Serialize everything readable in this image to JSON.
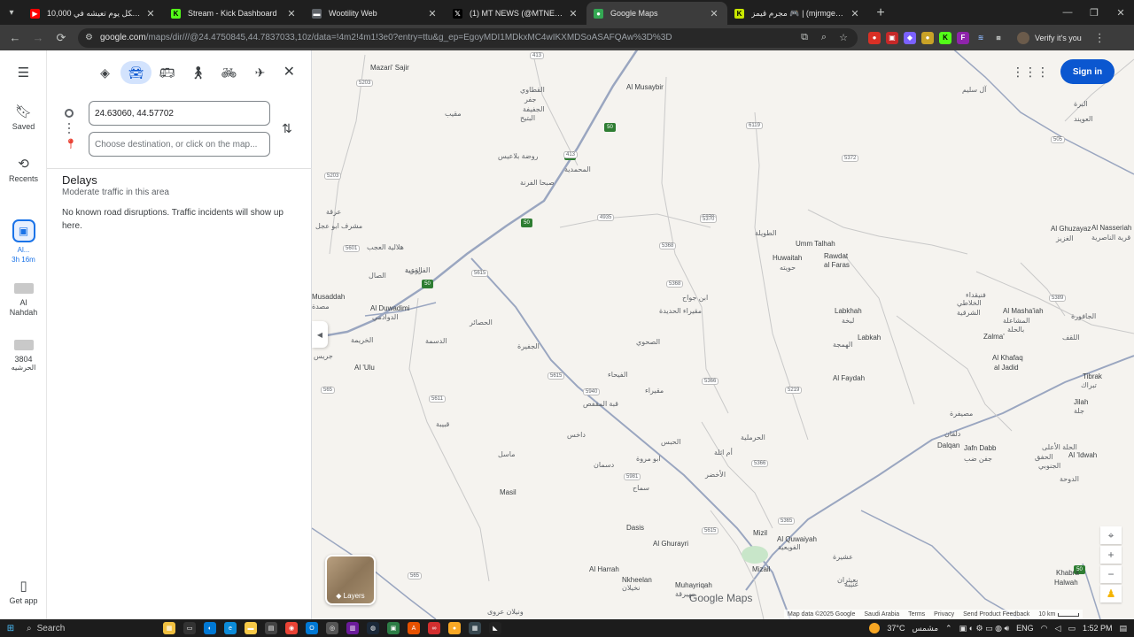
{
  "browser": {
    "tabs": [
      {
        "title": "10,000 ريال لكل يوم تعيشه في...",
        "favicon_color": "#ff0000",
        "active": false
      },
      {
        "title": "Stream - Kick Dashboard",
        "favicon_color": "#53fc18",
        "active": false
      },
      {
        "title": "Wootility Web",
        "favicon_color": "#5f6368",
        "active": false
      },
      {
        "title": "(1) MT NEWS (@MTNEWS_) / X",
        "favicon_color": "#000000",
        "active": false
      },
      {
        "title": "Google Maps",
        "favicon_color": "#34a853",
        "active": true
      },
      {
        "title": "مجرم قيمز 🎮 | (mjrmgems@) - ...",
        "favicon_color": "#c8e600",
        "active": false
      }
    ],
    "url_domain": "google.com",
    "url_path": "/maps/dir///@24.4750845,44.7837033,10z/data=!4m2!4m1!3e0?entry=ttu&g_ep=EgoyMDI1MDkxMC4wIKXMDSoASAFQAw%3D%3D",
    "profile_label": "Verify it's you"
  },
  "maps": {
    "rail": {
      "saved": "Saved",
      "recents": "Recents",
      "active_route_label": "Al...",
      "active_route_time": "3h 16m",
      "item2_label": "Al Nahdah",
      "item3_label_line1": "3804",
      "item3_label_line2": "الحرشيه",
      "get_app": "Get app"
    },
    "directions": {
      "origin_value": "24.63060, 44.57702",
      "destination_placeholder": "Choose destination, or click on the map...",
      "delays_title": "Delays",
      "delays_sub": "Moderate traffic in this area",
      "delays_body": "No known road disruptions. Traffic incidents will show up here."
    },
    "signin": "Sign in",
    "layers": "Layers",
    "logo": "Google Maps",
    "attribution": {
      "data": "Map data ©2025 Google",
      "country": "Saudi Arabia",
      "terms": "Terms",
      "privacy": "Privacy",
      "feedback": "Send Product Feedback",
      "scale": "10 km"
    },
    "places": [
      {
        "t": "Mazari' Sajir"
      },
      {
        "t": "القطاوي"
      },
      {
        "t": "جفر"
      },
      {
        "t": "الجفيفة"
      },
      {
        "t": "البتيح"
      },
      {
        "t": "مقيب"
      },
      {
        "t": "روضة بلاعيس"
      },
      {
        "t": "المحمدية"
      },
      {
        "t": "صبحا الفرنة"
      },
      {
        "t": "Al Musaybir"
      },
      {
        "t": "عرقة"
      },
      {
        "t": "مشرف ابو عجل"
      },
      {
        "t": "هلالية العجب"
      },
      {
        "t": "القرية"
      },
      {
        "t": "الطويلة"
      },
      {
        "t": "Umm Talhah"
      },
      {
        "t": "Huwaitah"
      },
      {
        "t": "حويته"
      },
      {
        "t": "Rawdat"
      },
      {
        "t": "al Faras"
      },
      {
        "t": "Al Ghuzayaz"
      },
      {
        "t": "الغزيز"
      },
      {
        "t": "Al Nasseriah"
      },
      {
        "t": "قرية الناصرية"
      },
      {
        "t": "الفرزعية"
      },
      {
        "t": "الصال"
      },
      {
        "t": "Musaddah"
      },
      {
        "t": "مصدة"
      },
      {
        "t": "Al Duwadimi"
      },
      {
        "t": "الدوادمي"
      },
      {
        "t": "الخريمة"
      },
      {
        "t": "Al 'Ulu"
      },
      {
        "t": "جريس"
      },
      {
        "t": "الدسمة"
      },
      {
        "t": "الحصائر"
      },
      {
        "t": "الجفيرة"
      },
      {
        "t": "ابن جواح"
      },
      {
        "t": "مقيراء الحديدة"
      },
      {
        "t": "الصحوي"
      },
      {
        "t": "Labkhah"
      },
      {
        "t": "لبخة"
      },
      {
        "t": "Labkah"
      },
      {
        "t": "الهمجة"
      },
      {
        "t": "فنيقداء"
      },
      {
        "t": "الخلاطي"
      },
      {
        "t": "الشرقية"
      },
      {
        "t": "Al Masha'iah"
      },
      {
        "t": "المشاعلة"
      },
      {
        "t": "بالحلة"
      },
      {
        "t": "الجافورة"
      },
      {
        "t": "Zalma'"
      },
      {
        "t": "اللقف"
      },
      {
        "t": "Al Khafaq"
      },
      {
        "t": "al Jadid"
      },
      {
        "t": "Tibrak"
      },
      {
        "t": "تبراك"
      },
      {
        "t": "Al Faydah"
      },
      {
        "t": "الفيحاء"
      },
      {
        "t": "مقيراء"
      },
      {
        "t": "قبة المقفص"
      },
      {
        "t": "قبيبة"
      },
      {
        "t": "داخس"
      },
      {
        "t": "ماسل"
      },
      {
        "t": "Masil"
      },
      {
        "t": "الحبس"
      },
      {
        "t": "ابو مروة"
      },
      {
        "t": "دسمان"
      },
      {
        "t": "سماح"
      },
      {
        "t": "أم اثلة"
      },
      {
        "t": "الأخضر"
      },
      {
        "t": "الحرملية"
      },
      {
        "t": "مصيفرة"
      },
      {
        "t": "دلقان"
      },
      {
        "t": "Dalqan"
      },
      {
        "t": "Jafn Dabb"
      },
      {
        "t": "جفن ضب"
      },
      {
        "t": "الحلة الأعلى"
      },
      {
        "t": "الحفق"
      },
      {
        "t": "الجنوبي"
      },
      {
        "t": "Jilah"
      },
      {
        "t": "جلة"
      },
      {
        "t": "Al 'Idwah"
      },
      {
        "t": "الدوحة"
      },
      {
        "t": "Dasis"
      },
      {
        "t": "Al Ghurayri"
      },
      {
        "t": "Mizil"
      },
      {
        "t": "Al Quwaiyah"
      },
      {
        "t": "الفويعية"
      },
      {
        "t": "Mizail"
      },
      {
        "t": "عشيرة"
      },
      {
        "t": "Al Harrah"
      },
      {
        "t": "Nkheelan"
      },
      {
        "t": "نخيلان"
      },
      {
        "t": "Muhayriqah"
      },
      {
        "t": "مهيرقة"
      },
      {
        "t": "بعيثران"
      },
      {
        "t": "عنيبة"
      },
      {
        "t": "Khabra"
      },
      {
        "t": "Halwah"
      },
      {
        "t": "ونيلان عروى"
      },
      {
        "t": "البرة"
      },
      {
        "t": "العويند"
      },
      {
        "t": "آل سليم"
      }
    ],
    "route_labels": [
      "5203",
      "413",
      "413",
      "6119",
      "5372",
      "5370",
      "4935",
      "5203",
      "5601",
      "5615",
      "5368",
      "5368",
      "5389",
      "5370",
      "5366",
      "6119",
      "5611",
      "5940",
      "5219",
      "5615",
      "5981",
      "5366",
      "5365",
      "5615",
      "505",
      "565",
      "565"
    ]
  },
  "taskbar": {
    "search": "Search",
    "weather": "37°C",
    "weather_desc": "مشمس",
    "lang": "ENG",
    "time": "1:52 PM"
  }
}
